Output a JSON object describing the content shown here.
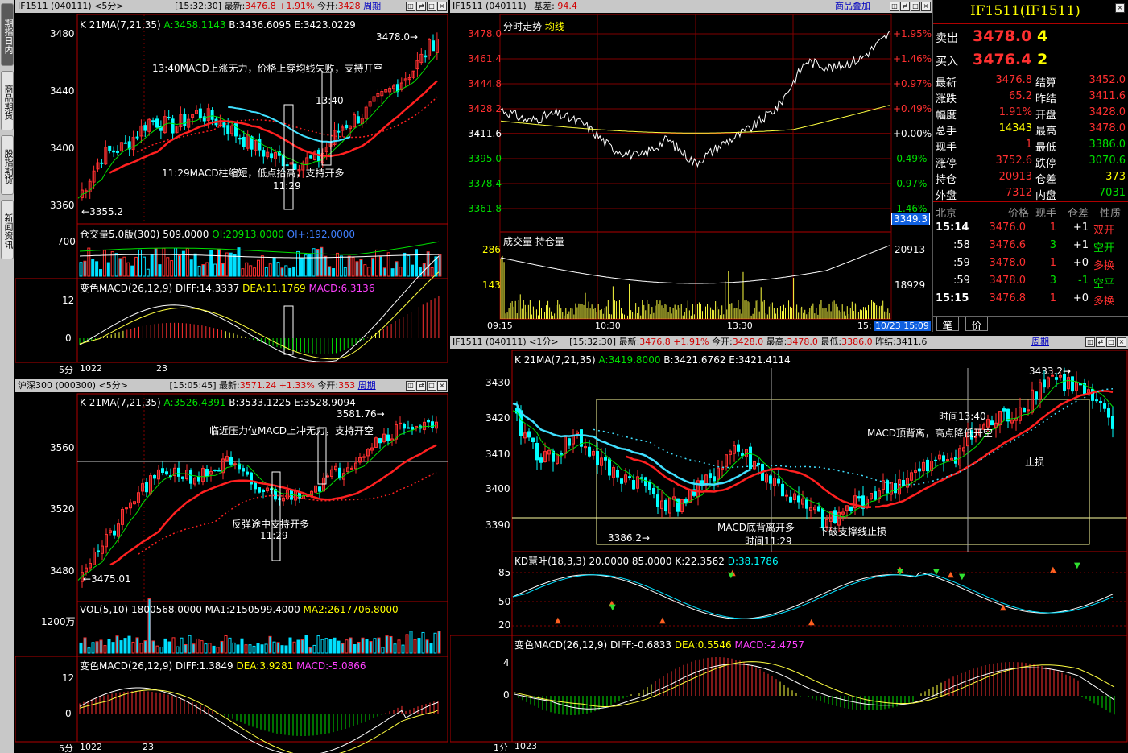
{
  "side_tabs": [
    "期指日内",
    "商品期货",
    "股指期货",
    "新闻资讯"
  ],
  "p1": {
    "header": {
      "code": "IF1511 (040111) <5分>",
      "time": "[15:32:30]",
      "latest_label": "最新:",
      "latest": "3476.8",
      "pct": "+1.91%",
      "open_label": "今开:",
      "open": "3428",
      "period": "周期"
    },
    "ma_line": {
      "k": "K",
      "ma": "21MA(7,21,35)",
      "a": "A:3458.1143",
      "b": "B:3436.6095",
      "e": "E:3423.0229"
    },
    "yticks": [
      "3480",
      "3440",
      "3400",
      "3360"
    ],
    "high": "3478.0",
    "low": "3355.2",
    "ann1": "13:40MACD上涨无力，价格上穿均线失败，支持开空",
    "ann2": "13:40",
    "ann3": "11:29MACD柱缩短，低点抬高，支持开多",
    "ann4": "11:29",
    "oi": {
      "title": "仓交量5.0版(300)",
      "v": "509.0000",
      "oi": "OI:20913.0000",
      "oip": "OI+:192.0000",
      "tick": "700"
    },
    "macd": {
      "title": "变色MACD(26,12,9)",
      "diff": "DIFF:14.3337",
      "dea": "DEA:11.1769",
      "macd": "MACD:6.3136",
      "ticks": [
        "12",
        "0"
      ]
    },
    "xaxis": {
      "period": "5分",
      "d1": "1022",
      "d2": "23"
    }
  },
  "p2": {
    "header": {
      "code": "沪深300 (000300) <5分>",
      "time": "[15:05:45]",
      "latest_label": "最新:",
      "latest": "3571.24",
      "pct": "+1.33%",
      "open_label": "今开:",
      "open": "353",
      "period": "周期"
    },
    "ma_line": {
      "k": "K",
      "ma": "21MA(7,21,35)",
      "a": "A:3526.4391",
      "b": "B:3533.1225",
      "e": "E:3528.9094"
    },
    "yticks": [
      "3560",
      "3520",
      "3480"
    ],
    "high": "3581.76",
    "low": "3475.01",
    "ann1": "临近压力位MACD上冲无力，支持开空",
    "ann2": "反弹途中支持开多",
    "ann3": "11:29",
    "vol": {
      "title": "VOL(5,10)",
      "v": "1800568.0000",
      "ma1": "MA1:2150599.4000",
      "ma2": "MA2:2617706.8000",
      "tick": "1200万"
    },
    "macd": {
      "title": "变色MACD(26,12,9)",
      "diff": "DIFF:1.3849",
      "dea": "DEA:3.9281",
      "macd": "MACD:-5.0866",
      "ticks": [
        "12",
        "0"
      ]
    },
    "xaxis": {
      "period": "5分",
      "d1": "1022",
      "d2": "23"
    }
  },
  "p3": {
    "header": {
      "code": "IF1511 (040111)",
      "basis_label": "基差:",
      "basis": "94.4",
      "link": "商品叠加"
    },
    "title": "分时走势",
    "avg": "均线",
    "left_ticks": [
      "3478.0",
      "3461.4",
      "3444.8",
      "3428.2",
      "3411.6",
      "3395.0",
      "3378.4",
      "3361.8"
    ],
    "right_ticks": [
      "+1.95%",
      "+1.46%",
      "+0.97%",
      "+0.49%",
      "+0.00%",
      "-0.49%",
      "-0.97%",
      "-1.46%"
    ],
    "cursor": "3349.3",
    "vol_title": "成交量",
    "oi_title": "持仓量",
    "vol_ticks": [
      "286",
      "143"
    ],
    "oi_ticks": [
      "20913",
      "18929"
    ],
    "xlabels": [
      "09:15",
      "10:30",
      "13:30",
      "15:"
    ],
    "date": "10/23 15:09"
  },
  "quote": {
    "title": "IF1511(IF1511)",
    "sell": {
      "label": "卖出",
      "price": "3478.0",
      "qty": "4"
    },
    "buy": {
      "label": "买入",
      "price": "3476.4",
      "qty": "2"
    },
    "rows": [
      [
        "最新",
        "3476.8",
        "结算",
        "3452.0"
      ],
      [
        "涨跌",
        "65.2",
        "昨结",
        "3411.6"
      ],
      [
        "幅度",
        "1.91%",
        "开盘",
        "3428.0"
      ],
      [
        "总手",
        "14343",
        "最高",
        "3478.0"
      ],
      [
        "现手",
        "1",
        "最低",
        "3386.0"
      ],
      [
        "涨停",
        "3752.6",
        "跌停",
        "3070.6"
      ],
      [
        "持仓",
        "20913",
        "仓差",
        "373"
      ],
      [
        "外盘",
        "7312",
        "内盘",
        "7031"
      ]
    ],
    "tick_header": [
      "北京",
      "价格",
      "现手",
      "仓差",
      "性质"
    ],
    "ticks": [
      [
        "15:14",
        "3476.0",
        "1",
        "+1",
        "双开"
      ],
      [
        ":58",
        "3476.6",
        "3",
        "+1",
        "空开"
      ],
      [
        ":59",
        "3478.0",
        "1",
        "+0",
        "多换"
      ],
      [
        ":59",
        "3478.0",
        "3",
        "-1",
        "空平"
      ],
      [
        "15:15",
        "3476.8",
        "1",
        "+0",
        "多换"
      ]
    ],
    "tabs": [
      "笔",
      "价"
    ]
  },
  "p4": {
    "header": {
      "code": "IF1511 (040111) <1分>",
      "time": "[15:32:30]",
      "latest_label": "最新:",
      "latest": "3476.8",
      "pct": "+1.91%",
      "open_label": "今开:",
      "open": "3428.0",
      "high_label": "最高:",
      "high": "3478.0",
      "low_label": "最低:",
      "low": "3386.0",
      "prev_label": "昨结:",
      "prev": "3411.6",
      "period": "周期"
    },
    "ma_line": {
      "k": "K",
      "ma": "21MA(7,21,35)",
      "a": "A:3419.8000",
      "b": "B:3421.6762",
      "e": "E:3421.4114"
    },
    "yticks": [
      "3430",
      "3420",
      "3410",
      "3400",
      "3390"
    ],
    "high": "3433.2",
    "low": "3386.2",
    "ann1": "时间13:40",
    "ann2": "MACD顶背离，高点降低开空",
    "ann3": "止损",
    "ann4": "MACD底背离开多",
    "ann5": "时间11:29",
    "ann6": "下破支撑线止损",
    "kd": {
      "title": "KD慧叶(18,3,3)",
      "v": "20.0000 85.0000",
      "k": "K:22.3562",
      "d": "D:38.1786",
      "ticks": [
        "85",
        "50",
        "20"
      ]
    },
    "macd": {
      "title": "变色MACD(26,12,9)",
      "diff": "DIFF:-0.6833",
      "dea": "DEA:0.5546",
      "macd": "MACD:-2.4757",
      "ticks": [
        "4",
        "0"
      ]
    },
    "xaxis": {
      "period": "1分",
      "d1": "1023"
    }
  },
  "colors": {
    "up": "#ff3030",
    "down": "#00ffff",
    "ma_a": "#00e000",
    "ma_b": "#ff2020",
    "ma_e": "#ff2020",
    "cyan": "#40e0ff",
    "yellow": "#ffff40",
    "grid": "#800000",
    "frame": "#b00000"
  }
}
